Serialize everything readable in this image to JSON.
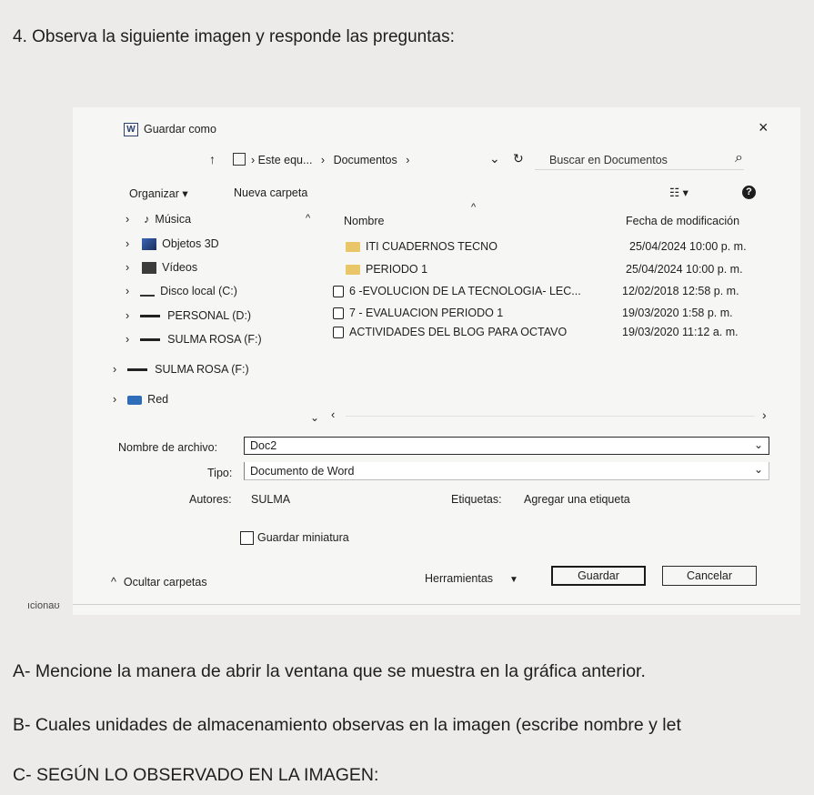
{
  "question": {
    "heading": "4.  Observa la siguiente imagen y responde las preguntas:",
    "a": "A-  Mencione la manera  de abrir la ventana que se muestra en la gráfica anterior.",
    "b": "B-  Cuales unidades de almacenamiento observas en la imagen (escribe nombre y let",
    "c": "C-  SEGÚN LO OBSERVADO EN LA IMAGEN:"
  },
  "dialog": {
    "title": "Guardar como",
    "title_icon": "W",
    "close_symbol": "×",
    "nav": {
      "up_symbol": "↑",
      "sep": "›",
      "crumb_pc": "Este equ...",
      "crumb_docs": "Documentos",
      "dropdown_symbol": "⌄",
      "refresh_symbol": "↻",
      "search_placeholder": "Buscar en Documentos",
      "search_symbol": "⌕"
    },
    "toolbar": {
      "organize": "Organizar ▾",
      "new_folder": "Nueva carpeta",
      "view_symbol": "☷ ▾",
      "help_symbol": "?"
    },
    "sidebar": [
      {
        "label": "Música"
      },
      {
        "label": "Objetos 3D"
      },
      {
        "label": "Vídeos"
      },
      {
        "label": "Disco local (C:)"
      },
      {
        "label": "PERSONAL (D:)"
      },
      {
        "label": "SULMA ROSA (F:)"
      },
      {
        "label": "SULMA ROSA (F:)"
      },
      {
        "label": "Red"
      }
    ],
    "columns": {
      "name": "Nombre",
      "date": "Fecha de modificación"
    },
    "files": [
      {
        "name": "ITI CUADERNOS TECNO",
        "date": "25/04/2024 10:00 p. m."
      },
      {
        "name": "PERIODO 1",
        "date": "25/04/2024 10:00 p. m."
      },
      {
        "name": "6 -EVOLUCION DE LA TECNOLOGIA- LEC...",
        "date": "12/02/2018 12:58 p. m."
      },
      {
        "name": "7 - EVALUACION PERIODO 1",
        "date": "19/03/2020 1:58 p. m."
      },
      {
        "name": "ACTIVIDADES DEL BLOG PARA OCTAVO",
        "date": "19/03/2020 11:12 a. m."
      }
    ],
    "scroll": {
      "left": "‹",
      "right": "›"
    },
    "filename_label": "Nombre de archivo:",
    "filename_value": "Doc2",
    "type_label": "Tipo:",
    "type_value": "Documento de Word",
    "authors_label": "Autores:",
    "authors_value": "SULMA",
    "tags_label": "Etiquetas:",
    "tags_value": "Agregar una etiqueta",
    "thumbnail_label": "Guardar miniatura",
    "hide_folders": "Ocultar carpetas",
    "tools": "Herramientas",
    "save": "Guardar",
    "cancel": "Cancelar",
    "partial_text": "ıcionaʊ"
  }
}
